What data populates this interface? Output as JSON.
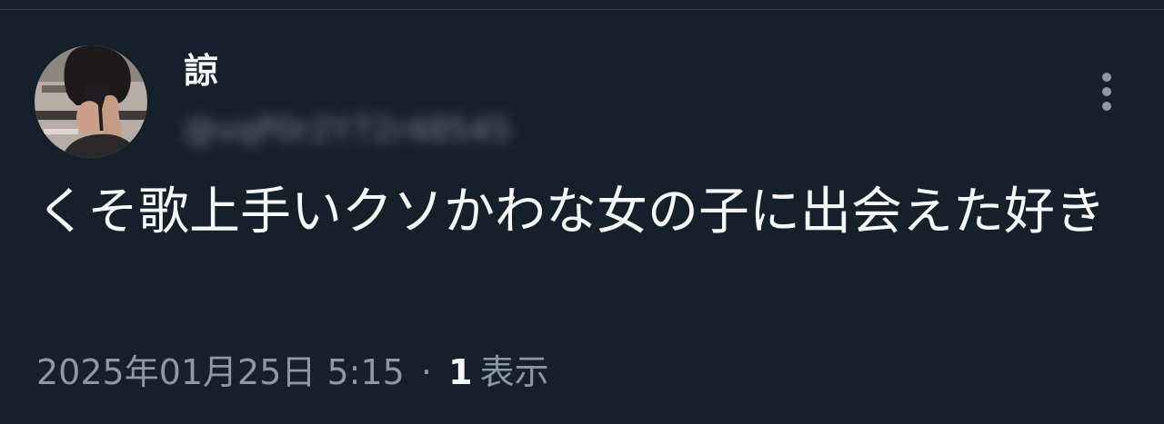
{
  "tweet": {
    "display_name": "諒",
    "handle": "@vqP0r2Y72r48545",
    "text": "くそ歌上手いクソかわな女の子に出会えた好き",
    "timestamp": "2025年01月25日 5:15",
    "separator": "·",
    "views_count": "1",
    "views_label": "表示"
  },
  "actions": {
    "more_icon": "more-vertical-icon"
  },
  "colors": {
    "background": "#15202b",
    "text_primary": "#f7f9f9",
    "text_secondary": "#8b98a5",
    "divider": "#38444d"
  }
}
